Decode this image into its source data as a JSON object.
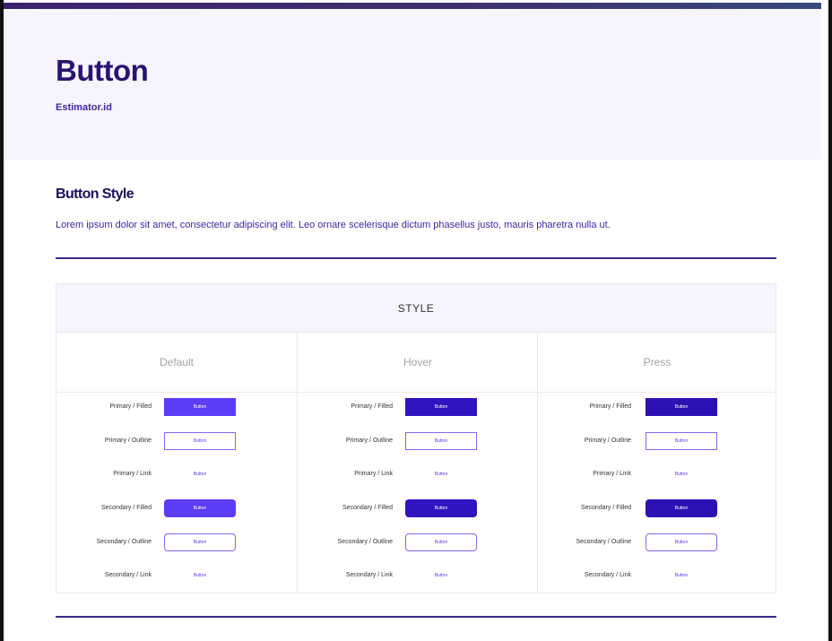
{
  "hero": {
    "title": "Button",
    "subtitle": "Estimator.id"
  },
  "section": {
    "title": "Button Style",
    "description": "Lorem ipsum dolor sit amet, consectetur adipiscing elit. Leo ornare scelerisque dictum phasellus justo, mauris pharetra nulla ut."
  },
  "table": {
    "header": "STYLE",
    "columns": [
      {
        "state": "Default",
        "filled_color": "#5b3df5",
        "outline_text_color": "#5a3cf2",
        "rows": [
          {
            "label": "Primary / Filled",
            "button": "Button"
          },
          {
            "label": "Primary / Outline",
            "button": "Button"
          },
          {
            "label": "Primary / Link",
            "button": "Button"
          },
          {
            "label": "Secondary / Filled",
            "button": "Button"
          },
          {
            "label": "Secondary / Outline",
            "button": "Button"
          },
          {
            "label": "Secondary / Link",
            "button": "Button"
          }
        ]
      },
      {
        "state": "Hover",
        "filled_color": "#2f14c0",
        "outline_text_color": "#5a3cf2",
        "rows": [
          {
            "label": "Primary / Filled",
            "button": "Button"
          },
          {
            "label": "Primary / Outline",
            "button": "Button"
          },
          {
            "label": "Primary / Link",
            "button": "Button"
          },
          {
            "label": "Secondary / Filled",
            "button": "Button"
          },
          {
            "label": "Secondary / Outline",
            "button": "Button"
          },
          {
            "label": "Secondary / Link",
            "button": "Button"
          }
        ]
      },
      {
        "state": "Press",
        "filled_color": "#2a12b3",
        "outline_text_color": "#5a3cf2",
        "rows": [
          {
            "label": "Primary / Filled",
            "button": "Button"
          },
          {
            "label": "Primary / Outline",
            "button": "Button"
          },
          {
            "label": "Primary / Link",
            "button": "Button"
          },
          {
            "label": "Secondary / Filled",
            "button": "Button"
          },
          {
            "label": "Secondary / Outline",
            "button": "Button"
          },
          {
            "label": "Secondary / Link",
            "button": "Button"
          }
        ]
      }
    ]
  }
}
